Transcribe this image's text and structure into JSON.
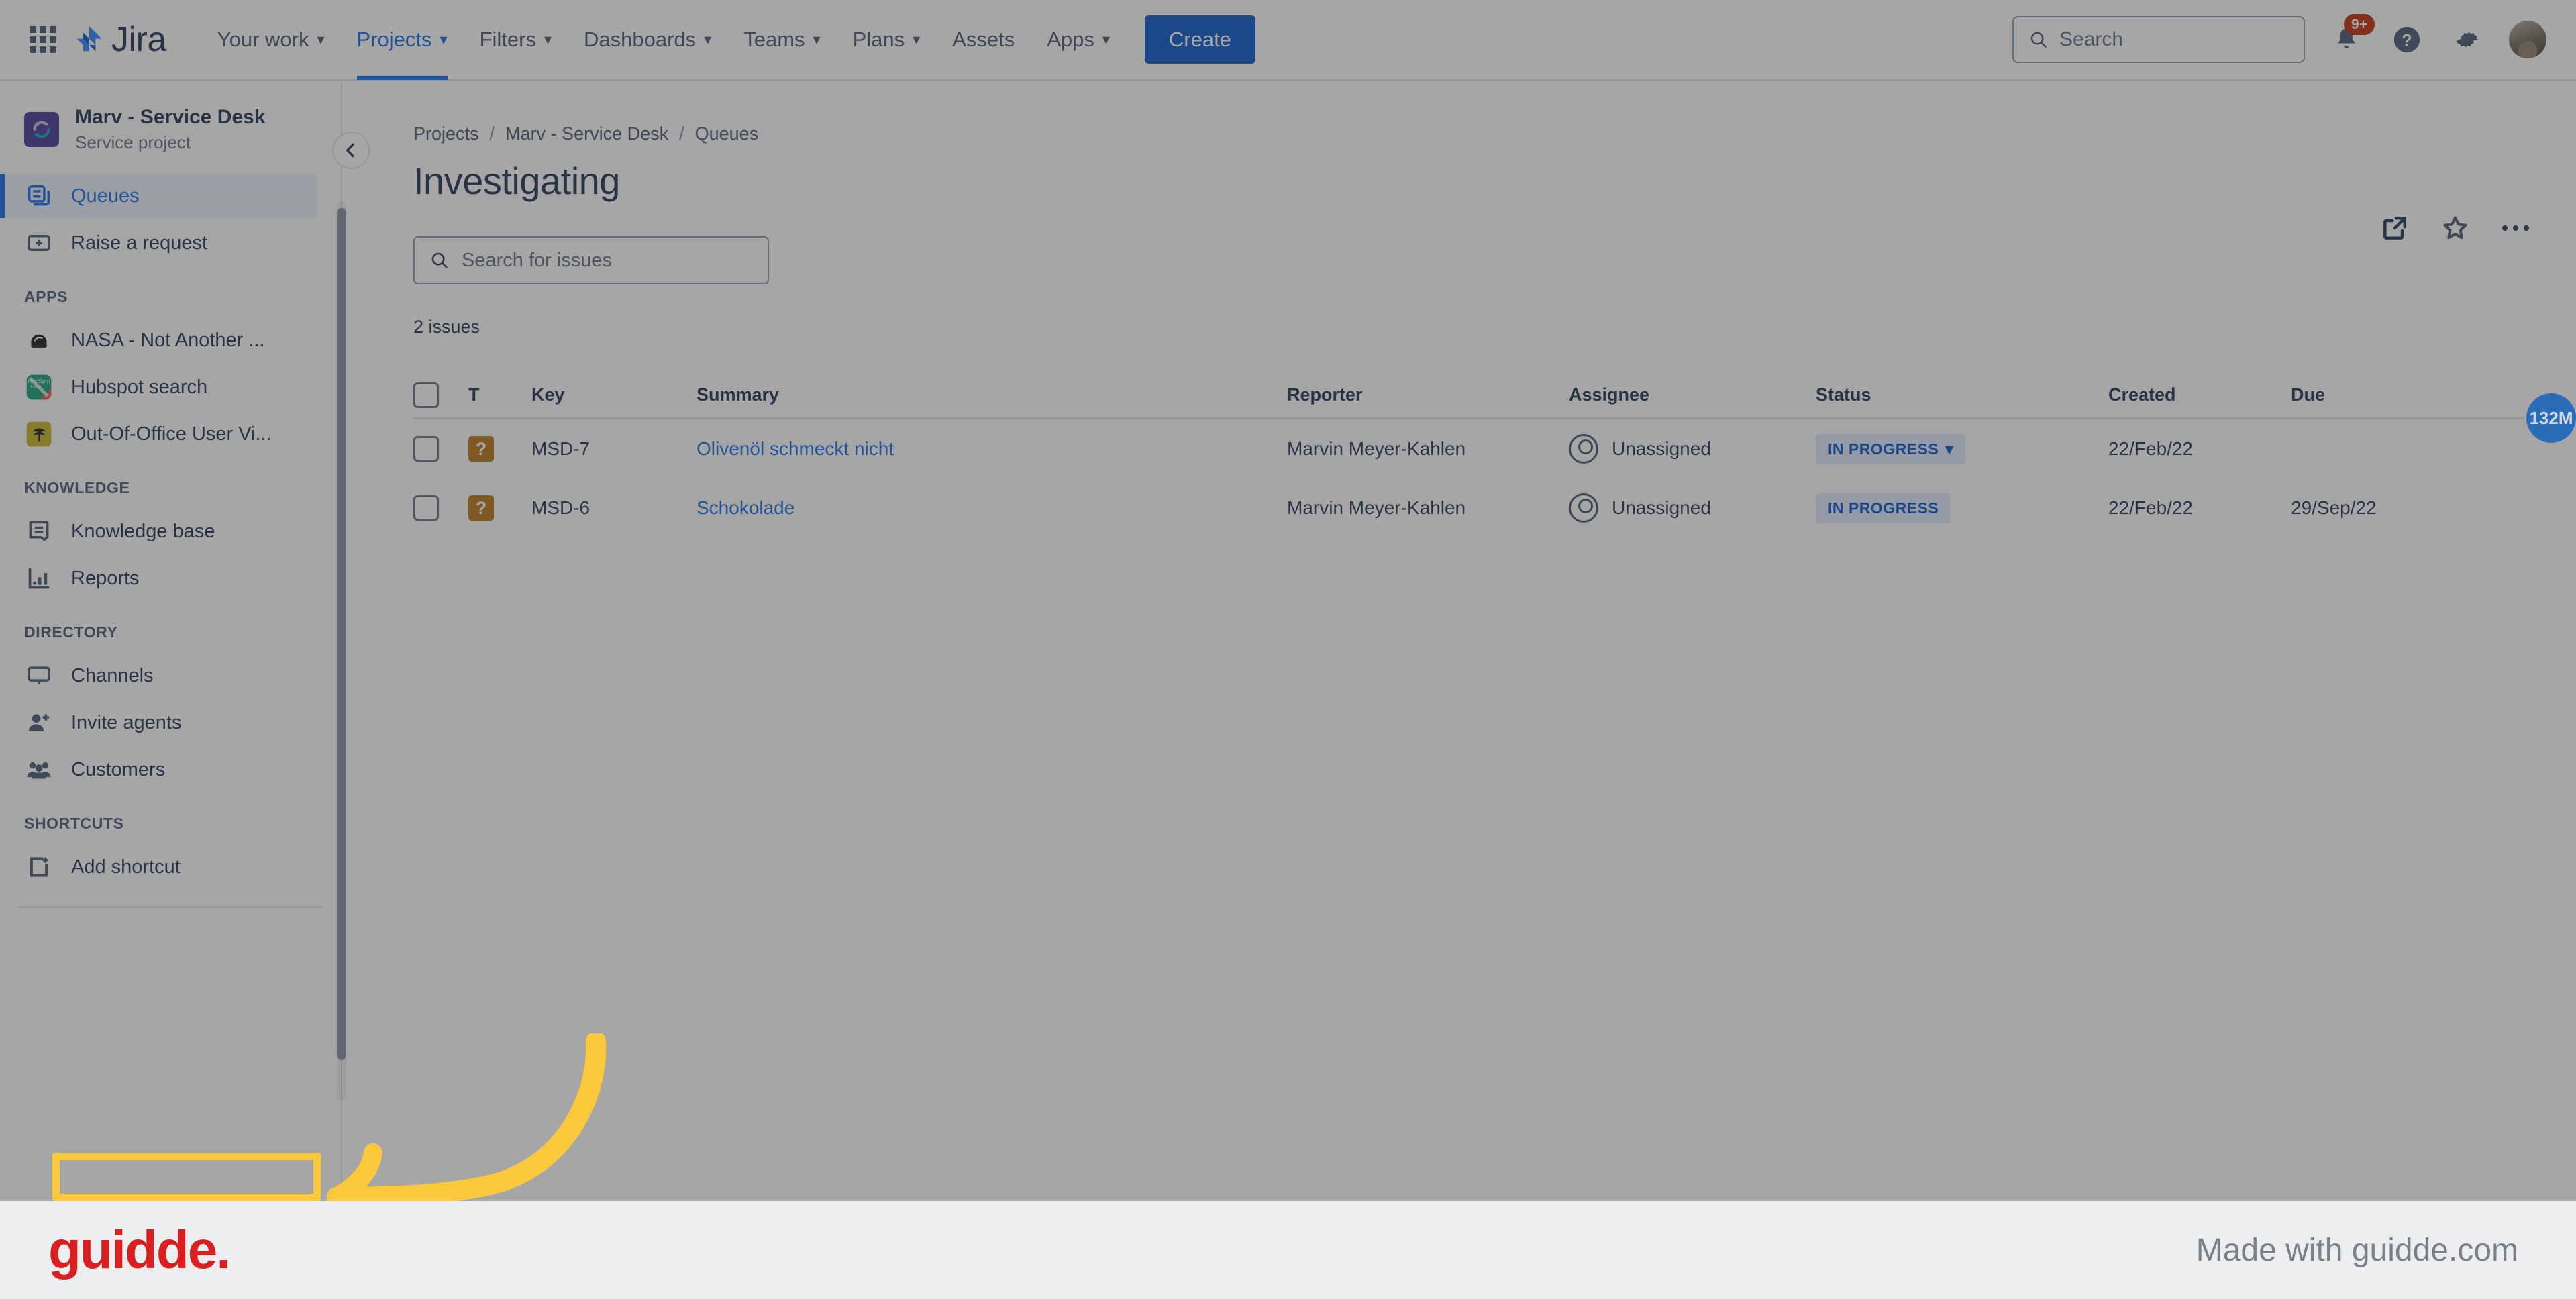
{
  "topnav": {
    "app_switcher": "apps-grid",
    "brand": "Jira",
    "items": [
      {
        "label": "Your work",
        "has_chevron": true,
        "active": false
      },
      {
        "label": "Projects",
        "has_chevron": true,
        "active": true
      },
      {
        "label": "Filters",
        "has_chevron": true,
        "active": false
      },
      {
        "label": "Dashboards",
        "has_chevron": true,
        "active": false
      },
      {
        "label": "Teams",
        "has_chevron": true,
        "active": false
      },
      {
        "label": "Plans",
        "has_chevron": true,
        "active": false
      },
      {
        "label": "Assets",
        "has_chevron": false,
        "active": false
      },
      {
        "label": "Apps",
        "has_chevron": true,
        "active": false
      }
    ],
    "create_label": "Create",
    "search_placeholder": "Search",
    "notification_badge": "9+",
    "brand_color": "#0052cc"
  },
  "sidebar": {
    "project_name": "Marv - Service Desk",
    "project_type": "Service project",
    "primary_items": [
      {
        "label": "Queues",
        "icon": "queues-icon",
        "selected": true
      },
      {
        "label": "Raise a request",
        "icon": "raise-request-icon",
        "selected": false
      }
    ],
    "sections": [
      {
        "title": "APPS",
        "items": [
          {
            "label": "NASA - Not Another ...",
            "icon": "nasa-app-icon",
            "tile_color": "#ffffff"
          },
          {
            "label": "Hubspot search",
            "icon": "hubspot-app-icon",
            "tile_color": "#0d9b76"
          },
          {
            "label": "Out-Of-Office User Vi...",
            "icon": "out-of-office-app-icon",
            "tile_color": "#c7b21a"
          }
        ]
      },
      {
        "title": "KNOWLEDGE",
        "items": [
          {
            "label": "Knowledge base",
            "icon": "knowledge-base-icon"
          },
          {
            "label": "Reports",
            "icon": "reports-icon"
          }
        ]
      },
      {
        "title": "DIRECTORY",
        "items": [
          {
            "label": "Channels",
            "icon": "channels-icon"
          },
          {
            "label": "Invite agents",
            "icon": "invite-agents-icon"
          },
          {
            "label": "Customers",
            "icon": "customers-icon"
          }
        ]
      },
      {
        "title": "SHORTCUTS",
        "items": [
          {
            "label": "Add shortcut",
            "icon": "add-shortcut-icon"
          }
        ]
      }
    ]
  },
  "main": {
    "breadcrumb": [
      "Projects",
      "Marv - Service Desk",
      "Queues"
    ],
    "breadcrumb_separator": "/",
    "title": "Investigating",
    "issue_search_placeholder": "Search for issues",
    "issue_count": "2 issues",
    "actions": [
      {
        "name": "share-icon"
      },
      {
        "name": "star-icon"
      },
      {
        "name": "more-options-icon"
      }
    ],
    "edge_badge": "132M"
  },
  "table": {
    "columns": [
      "",
      "T",
      "Key",
      "Summary",
      "Reporter",
      "Assignee",
      "Status",
      "Created",
      "Due"
    ],
    "rows": [
      {
        "key": "MSD-7",
        "type": "?",
        "summary": "Olivenöl schmeckt nicht",
        "reporter": "Marvin Meyer-Kahlen",
        "assignee": "Unassigned",
        "status": "IN PROGRESS",
        "status_has_chevron": true,
        "created": "22/Feb/22",
        "due": ""
      },
      {
        "key": "MSD-6",
        "type": "?",
        "summary": "Schokolade",
        "reporter": "Marvin Meyer-Kahlen",
        "assignee": "Unassigned",
        "status": "IN PROGRESS",
        "status_has_chevron": false,
        "created": "22/Feb/22",
        "due": "29/Sep/22"
      }
    ],
    "status_color": "#0052cc",
    "status_bg": "#deebff",
    "type_icon_color": "#b8700d"
  },
  "footer": {
    "logo": "guidde.",
    "tagline": "Made with guidde.com",
    "logo_color": "#d91f1f",
    "bg": "#eceef0"
  },
  "annotation": {
    "highlight_color": "#fcc93c"
  }
}
